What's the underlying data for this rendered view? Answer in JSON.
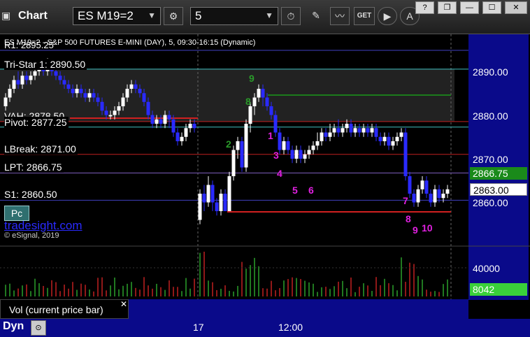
{
  "window": {
    "title": "Chart"
  },
  "toolbar": {
    "symbol": "ES M19=2",
    "interval": "5",
    "icons": [
      "gear-icon",
      "clock-icon",
      "pencil-icon",
      "indicator-icon",
      "get-icon",
      "play-icon",
      "cursor-icon"
    ],
    "get_label": "GET"
  },
  "window_buttons": [
    "help-icon",
    "restore-icon",
    "minimize-icon",
    "maximize-icon",
    "close-icon"
  ],
  "chart": {
    "banner": "ES M19=2 - S&P 500 FUTURES E-MINI (DAY), 5, 09:30-16:15 (Dynamic)",
    "banner_prefix": "R1: 2895.25",
    "pc_label": "Pc",
    "tradesight": "tradesight.com",
    "copyright": "© eSignal, 2019",
    "levels": [
      {
        "label": "Tri-Star 1: 2890.50",
        "price": 2890.5,
        "color": "#40c0c0"
      },
      {
        "label": "VAH: 2878.50",
        "price": 2878.5,
        "color": "#c02020"
      },
      {
        "label": "Pivot: 2877.25",
        "price": 2877.25,
        "color": "#40c0c0"
      },
      {
        "label": "LBreak: 2871.00",
        "price": 2871.0,
        "color": "#c02020"
      },
      {
        "label": "LPT: 2866.75",
        "price": 2866.75,
        "color": "#8060c0"
      },
      {
        "label": "S1: 2860.50",
        "price": 2860.5,
        "color": "#4040c0"
      }
    ],
    "price_scale": [
      "2890.00",
      "2880.00",
      "2870.00",
      "2860.00"
    ],
    "last_price": "2863.00",
    "lpt_tag": "2866.75",
    "td_counts": [
      {
        "text": "9",
        "color": "#2a9a2a"
      },
      {
        "text": "8",
        "color": "#2a9a2a"
      },
      {
        "text": "2",
        "color": "#2a9a2a"
      },
      {
        "text": "1",
        "color": "#e020e0"
      },
      {
        "text": "3",
        "color": "#e020e0"
      },
      {
        "text": "4",
        "color": "#e020e0"
      },
      {
        "text": "5",
        "color": "#e020e0"
      },
      {
        "text": "6",
        "color": "#e020e0"
      },
      {
        "text": "7",
        "color": "#e020e0"
      },
      {
        "text": "8",
        "color": "#e020e0"
      },
      {
        "text": "9",
        "color": "#e020e0"
      },
      {
        "text": "10",
        "color": "#e020e0"
      }
    ]
  },
  "volume": {
    "label": "Vol (current price bar)",
    "scale": "40000",
    "current": "8042"
  },
  "time_axis": {
    "labels": [
      "17",
      "12:00"
    ],
    "dyn_label": "Dyn"
  },
  "colors": {
    "up_bar": "#ffffff",
    "down_bar": "#2a2aff",
    "vol_up": "#2aa02a",
    "vol_down": "#c02020",
    "background": "#000000",
    "scale_bg": "#0a0a8a"
  }
}
